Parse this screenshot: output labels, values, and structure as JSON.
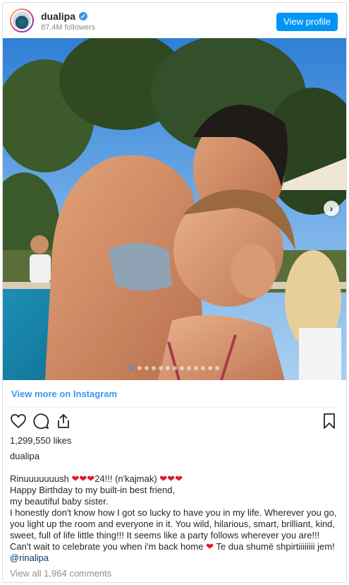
{
  "header": {
    "username": "dualipa",
    "verified_glyph": "✓",
    "followers": "87.4M followers",
    "view_profile_label": "View profile"
  },
  "carousel": {
    "slide_count": 13,
    "active_index": 0,
    "next_glyph": "›"
  },
  "links": {
    "view_more": "View more on Instagram"
  },
  "icons": {
    "like": "heart-outline-icon",
    "comment": "comment-icon",
    "share": "share-icon",
    "save": "bookmark-icon"
  },
  "post": {
    "likes": "1,299,550 likes",
    "caption_username": "dualipa",
    "caption": {
      "line1_a": "Rinuuuuuuush ",
      "line1_b": "24!!! (n'kajmak) ",
      "line2": "Happy Birthday to my built-in best friend,",
      "line3": "my beautiful baby sister.",
      "line4_a": "I honestly don't know how I got so lucky to have you in my life. Wherever you go, you light up the room and everyone in it. You wild, hilarious, smart, brilliant, kind, sweet, full of life little thing!!! It seems like a party follows wherever you are!!! Can't wait to celebrate you when i'm back home ",
      "line4_b": " Te dua shumë shpirtiiiiiiii jem! ",
      "mention": "@rinalipa",
      "heart_glyph": "❤"
    },
    "comments_link": "View all 1,964 comments"
  },
  "colors": {
    "accent": "#3897f0",
    "button": "#0095f6",
    "heart": "#e0162b"
  }
}
